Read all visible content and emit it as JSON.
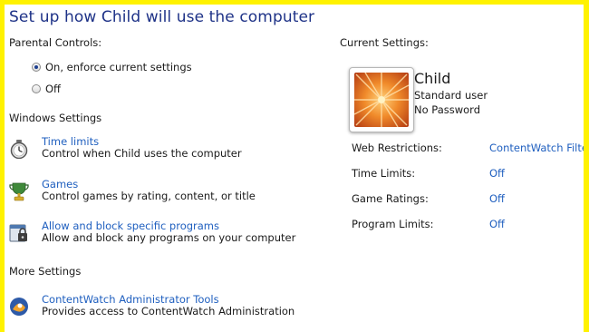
{
  "header": {
    "title": "Set up how Child will use the computer"
  },
  "parental_controls": {
    "heading": "Parental Controls:",
    "options": [
      {
        "label": "On, enforce current settings",
        "selected": true
      },
      {
        "label": "Off",
        "selected": false
      }
    ]
  },
  "windows_settings": {
    "heading": "Windows Settings",
    "items": [
      {
        "icon": "clock-icon",
        "link": "Time limits",
        "desc": "Control when Child uses the computer"
      },
      {
        "icon": "games-trophy-icon",
        "link": "Games",
        "desc": "Control games by rating, content, or title"
      },
      {
        "icon": "program-lock-icon",
        "link": "Allow and block specific programs",
        "desc": "Allow and block any programs on your computer"
      }
    ]
  },
  "more_settings": {
    "heading": "More Settings",
    "items": [
      {
        "icon": "contentwatch-icon",
        "link": "ContentWatch Administrator Tools",
        "desc": "Provides access to ContentWatch Administration"
      }
    ]
  },
  "current_settings": {
    "heading": "Current Settings:",
    "user": {
      "name": "Child",
      "type": "Standard user",
      "password": "No Password"
    },
    "rows": [
      {
        "label": "Web Restrictions:",
        "value": "ContentWatch Filter"
      },
      {
        "label": "Time Limits:",
        "value": "Off"
      },
      {
        "label": "Game Ratings:",
        "value": "Off"
      },
      {
        "label": "Program Limits:",
        "value": "Off"
      }
    ]
  },
  "colors": {
    "border": "#fff200",
    "title": "#1e3287",
    "link": "#1f5fbf"
  }
}
